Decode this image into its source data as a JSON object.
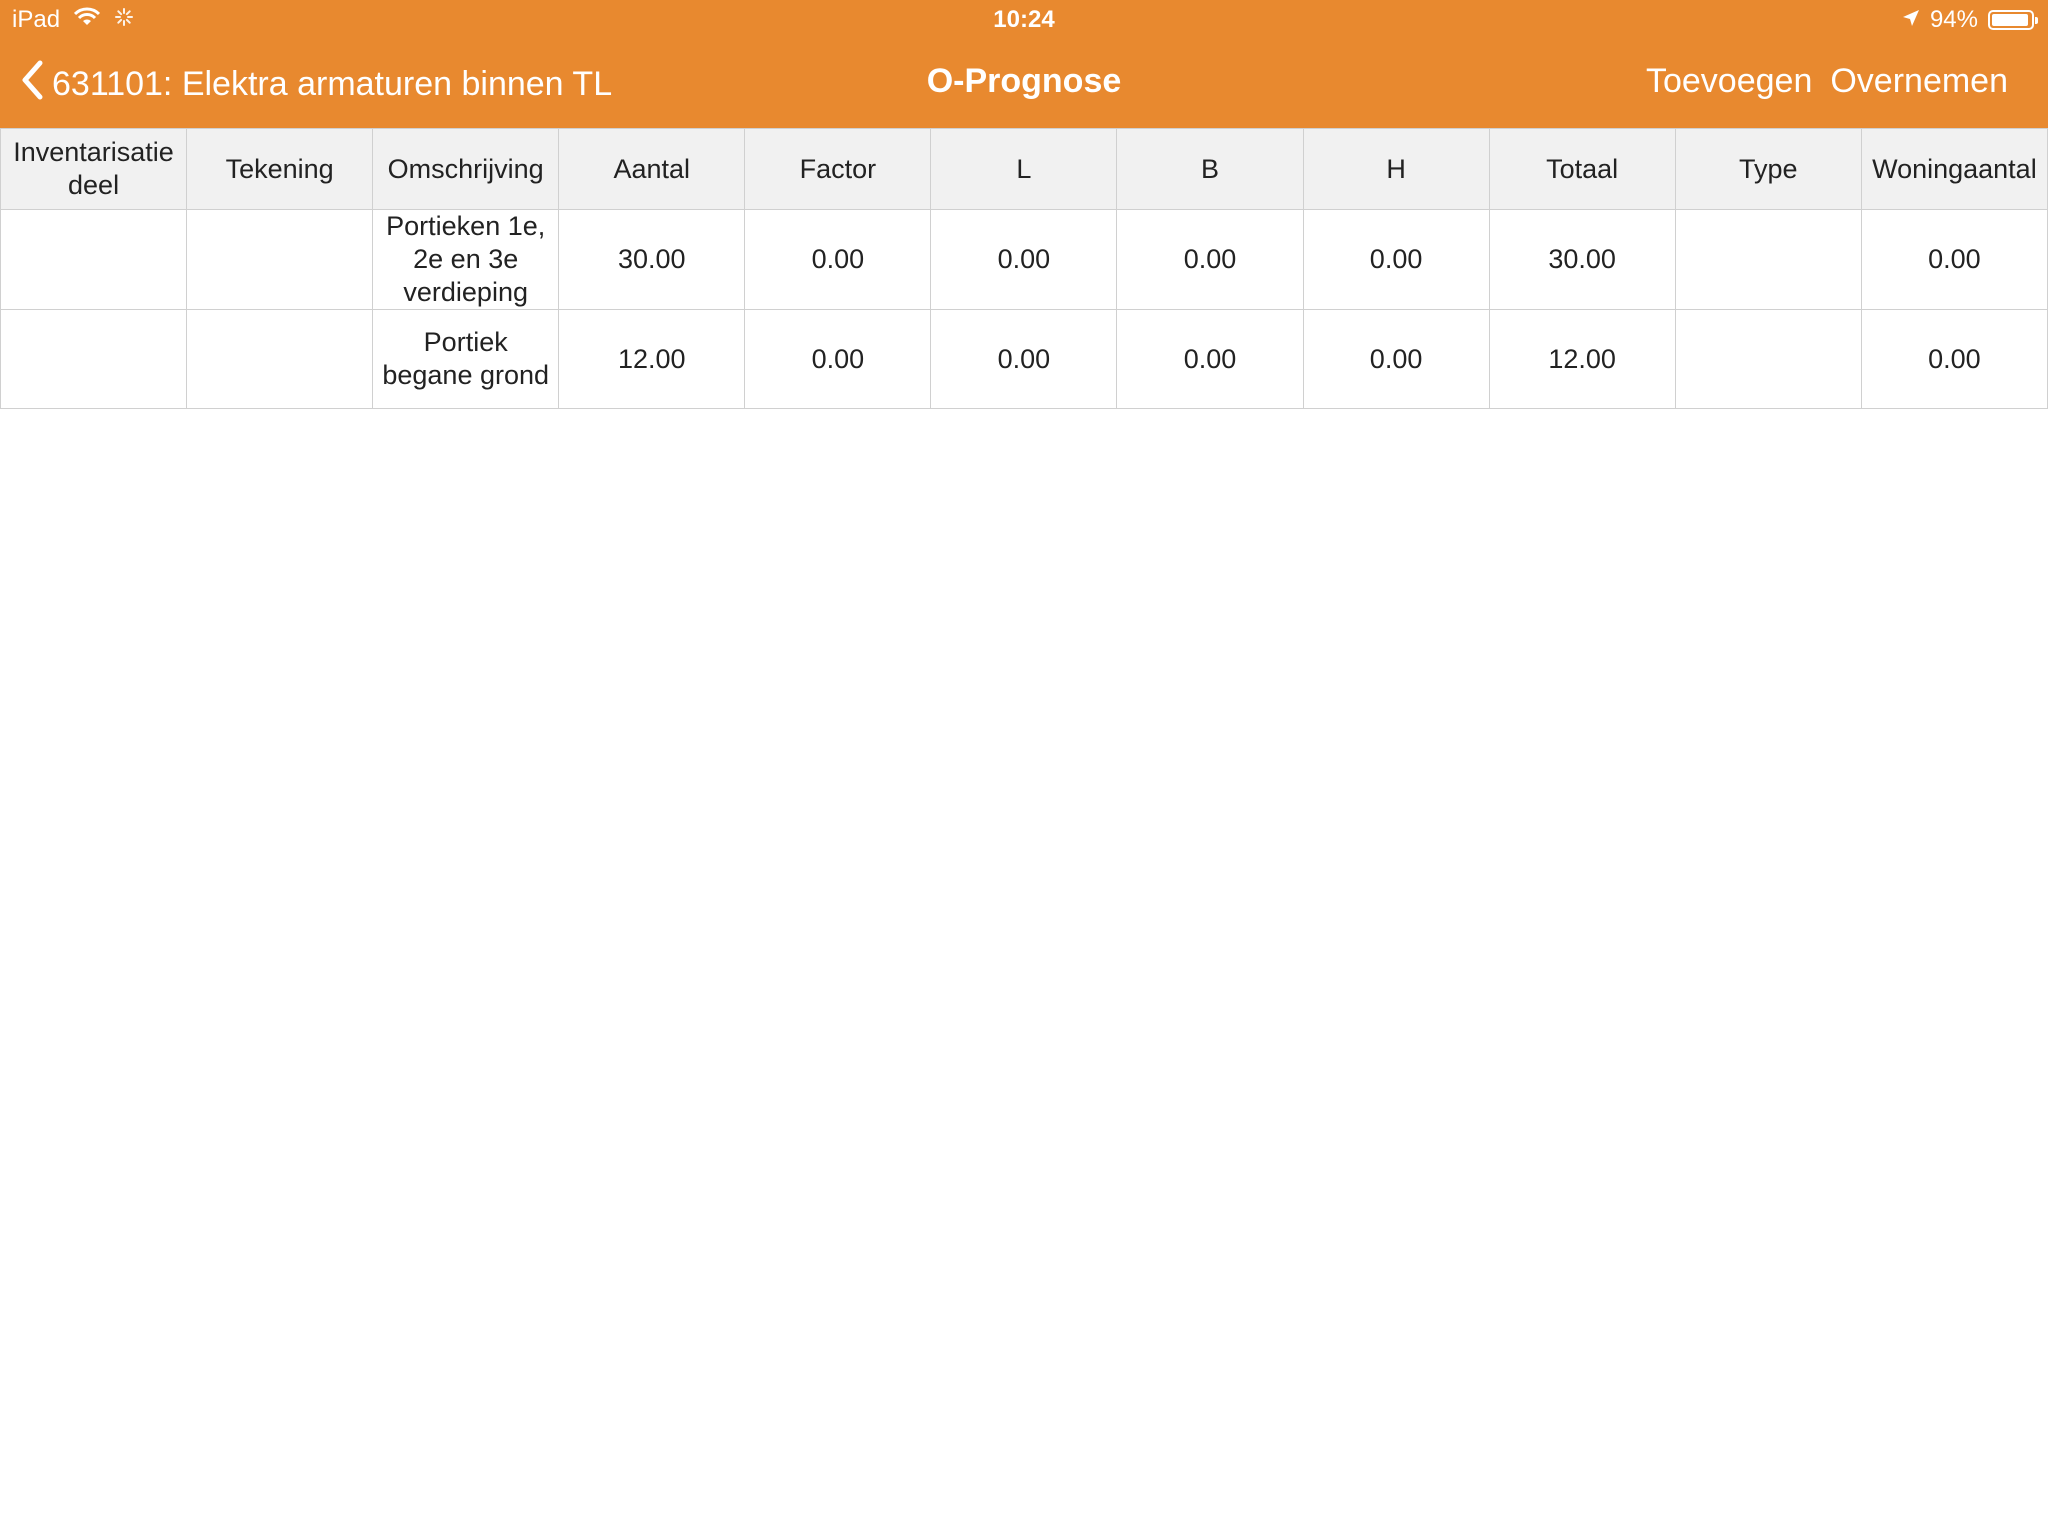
{
  "status_bar": {
    "device": "iPad",
    "time": "10:24",
    "battery_label": "94%",
    "battery_level": 0.94,
    "icons": [
      "wifi-icon",
      "activity-spinner-icon",
      "location-arrow-icon",
      "battery-icon"
    ]
  },
  "navbar": {
    "back_label": "631101: Elektra armaturen binnen TL",
    "title": "O-Prognose",
    "add_label": "Toevoegen",
    "adopt_label": "Overnemen"
  },
  "colors": {
    "accent": "#E8892F",
    "header_bg": "#F1F1F1",
    "grid_line": "#D0D0D0"
  },
  "table": {
    "columns": [
      "Inventarisatie deel",
      "Tekening",
      "Omschrijving",
      "Aantal",
      "Factor",
      "L",
      "B",
      "H",
      "Totaal",
      "Type",
      "Woningaantal"
    ],
    "rows": [
      [
        "",
        "",
        "Portieken 1e, 2e en 3e verdieping",
        "30.00",
        "0.00",
        "0.00",
        "0.00",
        "0.00",
        "30.00",
        "",
        "0.00"
      ],
      [
        "",
        "",
        "Portiek begane grond",
        "12.00",
        "0.00",
        "0.00",
        "0.00",
        "0.00",
        "12.00",
        "",
        "0.00"
      ]
    ]
  }
}
